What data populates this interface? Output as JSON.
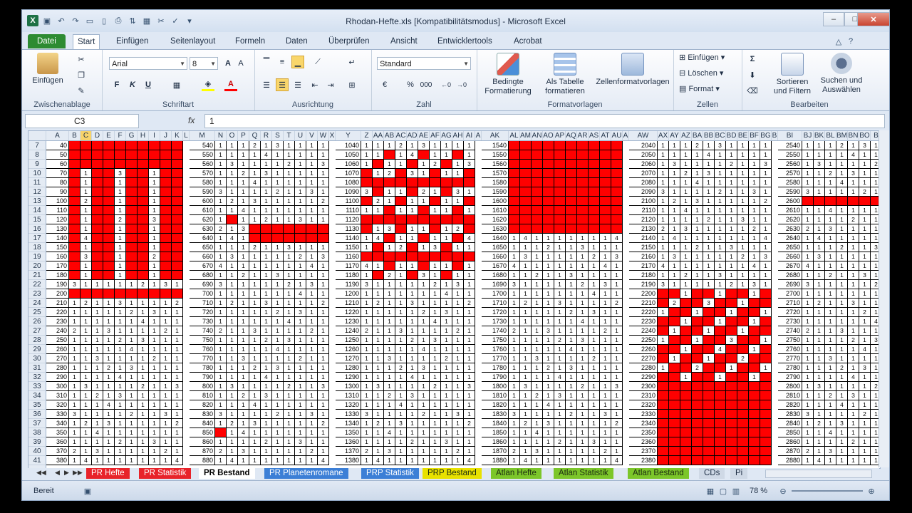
{
  "window": {
    "title": "Rhodan-Hefte.xls  [Kompatibilitätsmodus]  -  Microsoft Excel",
    "controls": {
      "minimize": "–",
      "maximize": "□",
      "close": "✕"
    }
  },
  "qat": {
    "logo": "X"
  },
  "tabs": [
    "Datei",
    "Start",
    "Einfügen",
    "Seitenlayout",
    "Formeln",
    "Daten",
    "Überprüfen",
    "Ansicht",
    "Entwicklertools",
    "Acrobat"
  ],
  "ribbon": {
    "clipboard": {
      "paste": "Einfügen",
      "label": "Zwischenablage"
    },
    "font": {
      "name": "Arial",
      "size": "8",
      "bold": "F",
      "italic": "K",
      "underline": "U",
      "label": "Schriftart"
    },
    "alignment": {
      "label": "Ausrichtung"
    },
    "number": {
      "format": "Standard",
      "percent": "%",
      "thousands": "000",
      "label": "Zahl"
    },
    "styles": {
      "conditional": "Bedingte Formatierung",
      "astable": "Als Tabelle formatieren",
      "cellstyles": "Zellenformatvorlagen",
      "label": "Formatvorlagen"
    },
    "cells": {
      "insert": "Einfügen",
      "delete": "Löschen",
      "format": "Format",
      "label": "Zellen"
    },
    "editing": {
      "sort": "Sortieren und Filtern",
      "find": "Suchen und Auswählen",
      "label": "Bearbeiten",
      "sigma": "Σ"
    }
  },
  "formulabar": {
    "namebox": "C3",
    "fx": "fx",
    "value": "1"
  },
  "columns": [
    "A",
    "B",
    "C",
    "D",
    "E",
    "F",
    "G",
    "H",
    "I",
    "J",
    "K",
    "L",
    "M",
    "N",
    "O",
    "P",
    "Q",
    "R",
    "S",
    "T",
    "U",
    "V",
    "W",
    "X",
    "Y",
    "Z",
    "AA",
    "AB",
    "AC",
    "AD",
    "AE",
    "AF",
    "AG",
    "AH",
    "AI",
    "A",
    "AK",
    "AL",
    "AM",
    "AN",
    "AO",
    "AP",
    "AQ",
    "AR",
    "AS",
    "AT",
    "AU",
    "A",
    "AW",
    "AX",
    "AY",
    "AZ",
    "BA",
    "BB",
    "BC",
    "BD",
    "BE",
    "BF",
    "BG",
    "B",
    "BI",
    "BJ",
    "BK",
    "BL",
    "BM",
    "BN",
    "BO",
    "B"
  ],
  "rows": [
    7,
    8,
    9,
    10,
    11,
    12,
    13,
    14,
    15,
    16,
    17,
    18,
    19,
    20,
    21,
    22,
    23,
    24,
    25,
    26,
    27,
    28,
    29,
    30,
    31,
    32,
    33,
    34,
    35,
    36,
    37,
    38,
    39,
    40,
    41
  ],
  "blocks": {
    "a": [
      "40",
      "50",
      "60",
      "70",
      "80",
      "90",
      "100",
      "110",
      "120",
      "130",
      "140",
      "150",
      "160",
      "170",
      "180",
      "190",
      "200",
      "210",
      "220",
      "230",
      "240",
      "250",
      "260",
      "270",
      "280",
      "290",
      "300",
      "310",
      "320",
      "330",
      "340",
      "350",
      "360",
      "370",
      "380"
    ],
    "m": [
      "540",
      "550",
      "560",
      "570",
      "580",
      "590",
      "600",
      "610",
      "620",
      "630",
      "640",
      "650",
      "660",
      "670",
      "680",
      "690",
      "700",
      "710",
      "720",
      "730",
      "740",
      "750",
      "760",
      "770",
      "780",
      "790",
      "800",
      "810",
      "820",
      "830",
      "840",
      "850",
      "860",
      "870",
      "880"
    ],
    "y": [
      "1040",
      "1050",
      "1060",
      "1070",
      "1080",
      "1090",
      "1100",
      "1110",
      "1120",
      "1130",
      "1140",
      "1150",
      "1160",
      "1170",
      "1180",
      "1190",
      "1200",
      "1210",
      "1220",
      "1230",
      "1240",
      "1250",
      "1260",
      "1270",
      "1280",
      "1290",
      "1300",
      "1310",
      "1320",
      "1330",
      "1340",
      "1350",
      "1360",
      "1370",
      "1380"
    ],
    "ak": [
      "1540",
      "1550",
      "1560",
      "1570",
      "1580",
      "1590",
      "1600",
      "1610",
      "1620",
      "1630",
      "1640",
      "1650",
      "1660",
      "1670",
      "1680",
      "1690",
      "1700",
      "1710",
      "1720",
      "1730",
      "1740",
      "1750",
      "1760",
      "1770",
      "1780",
      "1790",
      "1800",
      "1810",
      "1820",
      "1830",
      "1840",
      "1850",
      "1860",
      "1870",
      "1880"
    ],
    "aw": [
      "2040",
      "2050",
      "2060",
      "2070",
      "2080",
      "2090",
      "2100",
      "2110",
      "2120",
      "2130",
      "2140",
      "2150",
      "2160",
      "2170",
      "2180",
      "2190",
      "2200",
      "2210",
      "2220",
      "2230",
      "2240",
      "2250",
      "2260",
      "2270",
      "2280",
      "2290",
      "2300",
      "2310",
      "2320",
      "2330",
      "2340",
      "2350",
      "2360",
      "2370",
      "2380"
    ],
    "bi": [
      "2540",
      "2550",
      "2560",
      "2570",
      "2580",
      "2590",
      "2600",
      "2610",
      "2620",
      "2630",
      "2640",
      "2650",
      "2660",
      "2670",
      "2680",
      "2690",
      "2700",
      "2710",
      "2720",
      "2730",
      "2740",
      "2750",
      "2760",
      "2770",
      "2780",
      "2790",
      "2800",
      "2810",
      "2820",
      "2830",
      "2840",
      "2850",
      "2860",
      "2870",
      "2880"
    ]
  },
  "sheet_tabs": [
    {
      "label": "PR Hefte",
      "color": "#e8232a"
    },
    {
      "label": "PR Statistik",
      "color": "#e8232a"
    },
    {
      "label": "PR Bestand",
      "color": "#ffffff"
    },
    {
      "label": "PR Planetenromane",
      "color": "#3c7fd6"
    },
    {
      "label": "PRP Statistik",
      "color": "#3c7fd6"
    },
    {
      "label": "PRP Bestand",
      "color": "#e8e100"
    },
    {
      "label": "Atlan Hefte",
      "color": "#7cc62a"
    },
    {
      "label": "Atlan Statistik",
      "color": "#7cc62a"
    },
    {
      "label": "Atlan Bestand",
      "color": "#7cc62a"
    },
    {
      "label": "CDs",
      "color": "#cfd9e6"
    },
    {
      "label": "Pi",
      "color": "#cfd9e6"
    }
  ],
  "status": {
    "ready": "Bereit",
    "zoom": "78 %"
  }
}
